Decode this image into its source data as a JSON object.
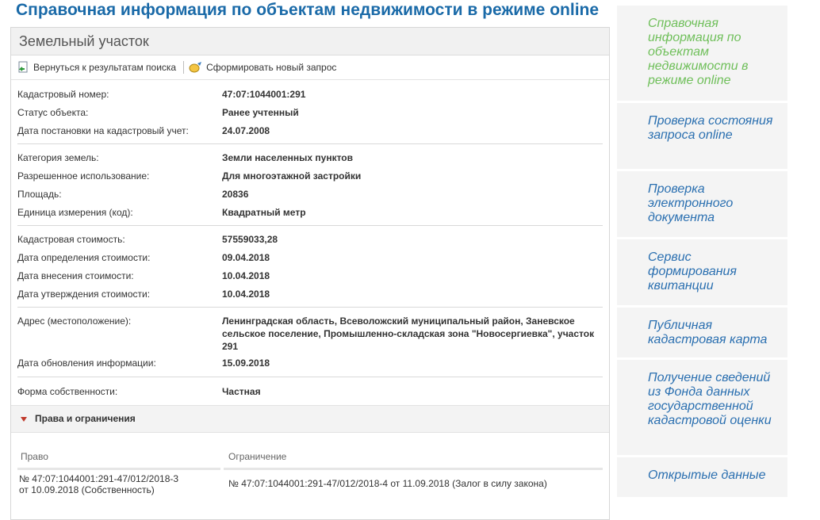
{
  "page": {
    "title": "Справочная информация по объектам недвижимости в режиме online"
  },
  "panel": {
    "title": "Земельный участок"
  },
  "toolbar": {
    "back_label": "Вернуться к результатам поиска",
    "new_label": "Сформировать новый запрос"
  },
  "details": {
    "cadastral_number": {
      "label": "Кадастровый номер:",
      "value": "47:07:1044001:291"
    },
    "status": {
      "label": "Статус объекта:",
      "value": "Ранее учтенный"
    },
    "registration_date": {
      "label": "Дата постановки на кадастровый учет:",
      "value": "24.07.2008"
    },
    "land_category": {
      "label": "Категория земель:",
      "value": "Земли населенных пунктов"
    },
    "permitted_use": {
      "label": "Разрешенное использование:",
      "value": "Для многоэтажной застройки"
    },
    "area": {
      "label": "Площадь:",
      "value": "20836"
    },
    "unit": {
      "label": "Единица измерения (код):",
      "value": "Квадратный метр"
    },
    "cadastral_value": {
      "label": "Кадастровая стоимость:",
      "value": "57559033,28"
    },
    "value_determination_date": {
      "label": "Дата определения стоимости:",
      "value": "09.04.2018"
    },
    "value_entry_date": {
      "label": "Дата внесения стоимости:",
      "value": "10.04.2018"
    },
    "value_approval_date": {
      "label": "Дата утверждения стоимости:",
      "value": "10.04.2018"
    },
    "address": {
      "label": "Адрес (местоположение):",
      "value": "Ленинградская область, Всеволожский муниципальный район, Заневское сельское поселение, Промышленно-складская зона \"Новосергиевка\", участок 291"
    },
    "update_date": {
      "label": "Дата обновления информации:",
      "value": "15.09.2018"
    },
    "ownership": {
      "label": "Форма собственности:",
      "value": "Частная"
    }
  },
  "rights": {
    "section_title": "Права и ограничения",
    "columns": [
      "Право",
      "Ограничение"
    ],
    "row": {
      "right": "№ 47:07:1044001:291-47/012/2018-3 от 10.09.2018 (Собственность)",
      "restriction": "№ 47:07:1044001:291-47/012/2018-4 от 11.09.2018 (Залог в силу закона)"
    }
  },
  "sidebar": {
    "items": [
      {
        "label": "Справочная информация по объектам недвижимости в режиме online"
      },
      {
        "label": "Проверка состояния запроса online"
      },
      {
        "label": "Проверка электронного документа"
      },
      {
        "label": "Сервис формирования квитанции"
      },
      {
        "label": "Публичная кадастровая карта"
      },
      {
        "label": "Получение сведений из Фонда данных государственной кадастровой оценки"
      },
      {
        "label": "Открытые данные"
      }
    ]
  },
  "colors": {
    "title_blue": "#1a6aa8",
    "link_blue": "#2a6fb0",
    "active_green": "#6fbf5a",
    "triangle_red": "#c0392b"
  }
}
